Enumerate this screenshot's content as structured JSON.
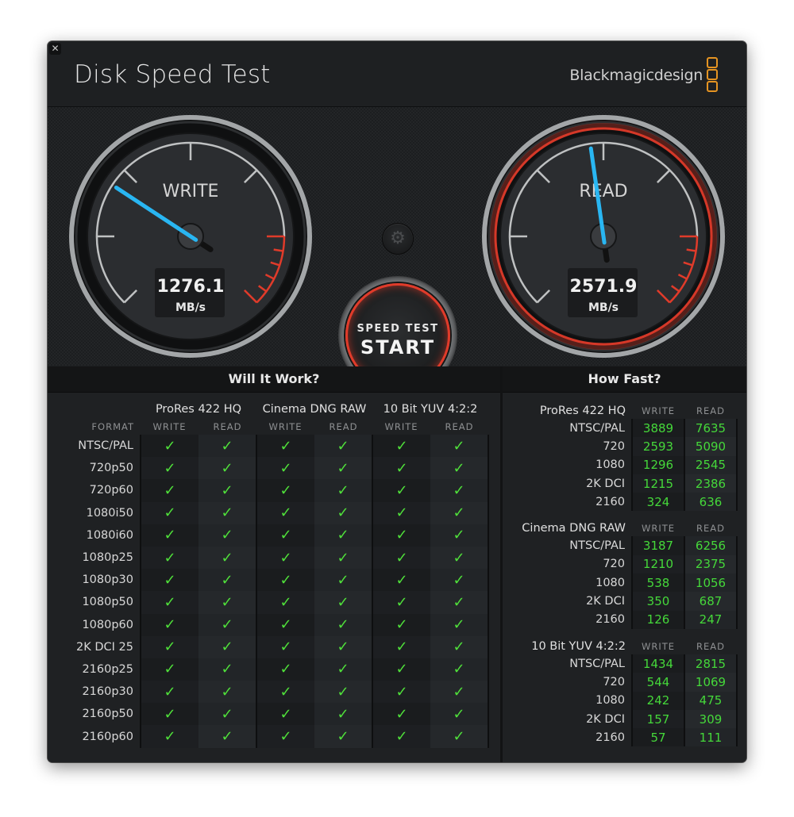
{
  "window": {
    "close_icon": "close-icon",
    "title": "Disk Speed Test",
    "brand": "Blackmagicdesign"
  },
  "colors": {
    "needle": "#29b6f2",
    "danger": "#e03b2a",
    "check": "#4fe03a",
    "value_green": "#45d83a",
    "logo": "#e59422"
  },
  "gauges": {
    "write": {
      "label": "WRITE",
      "value": "1276.1",
      "unit": "MB/s",
      "needle_fraction": 0.29
    },
    "read": {
      "label": "READ",
      "value": "2571.9",
      "unit": "MB/s",
      "needle_fraction": 0.47
    }
  },
  "controls": {
    "settings_icon": "gear-icon",
    "start_sub": "SPEED TEST",
    "start_main": "START"
  },
  "will_it_work": {
    "title": "Will It Work?",
    "format_header": "FORMAT",
    "codecs": [
      "ProRes 422 HQ",
      "Cinema DNG RAW",
      "10 Bit YUV 4:2:2"
    ],
    "columns": [
      "WRITE",
      "READ"
    ],
    "check_glyph": "✓",
    "rows": [
      {
        "format": "NTSC/PAL",
        "results": [
          true,
          true,
          true,
          true,
          true,
          true
        ]
      },
      {
        "format": "720p50",
        "results": [
          true,
          true,
          true,
          true,
          true,
          true
        ]
      },
      {
        "format": "720p60",
        "results": [
          true,
          true,
          true,
          true,
          true,
          true
        ]
      },
      {
        "format": "1080i50",
        "results": [
          true,
          true,
          true,
          true,
          true,
          true
        ]
      },
      {
        "format": "1080i60",
        "results": [
          true,
          true,
          true,
          true,
          true,
          true
        ]
      },
      {
        "format": "1080p25",
        "results": [
          true,
          true,
          true,
          true,
          true,
          true
        ]
      },
      {
        "format": "1080p30",
        "results": [
          true,
          true,
          true,
          true,
          true,
          true
        ]
      },
      {
        "format": "1080p50",
        "results": [
          true,
          true,
          true,
          true,
          true,
          true
        ]
      },
      {
        "format": "1080p60",
        "results": [
          true,
          true,
          true,
          true,
          true,
          true
        ]
      },
      {
        "format": "2K DCI 25",
        "results": [
          true,
          true,
          true,
          true,
          true,
          true
        ]
      },
      {
        "format": "2160p25",
        "results": [
          true,
          true,
          true,
          true,
          true,
          true
        ]
      },
      {
        "format": "2160p30",
        "results": [
          true,
          true,
          true,
          true,
          true,
          true
        ]
      },
      {
        "format": "2160p50",
        "results": [
          true,
          true,
          true,
          true,
          true,
          true
        ]
      },
      {
        "format": "2160p60",
        "results": [
          true,
          true,
          true,
          true,
          true,
          true
        ]
      }
    ]
  },
  "how_fast": {
    "title": "How Fast?",
    "columns": [
      "WRITE",
      "READ"
    ],
    "groups": [
      {
        "codec": "ProRes 422 HQ",
        "rows": [
          {
            "format": "NTSC/PAL",
            "write": "3889",
            "read": "7635"
          },
          {
            "format": "720",
            "write": "2593",
            "read": "5090"
          },
          {
            "format": "1080",
            "write": "1296",
            "read": "2545"
          },
          {
            "format": "2K DCI",
            "write": "1215",
            "read": "2386"
          },
          {
            "format": "2160",
            "write": "324",
            "read": "636"
          }
        ]
      },
      {
        "codec": "Cinema DNG RAW",
        "rows": [
          {
            "format": "NTSC/PAL",
            "write": "3187",
            "read": "6256"
          },
          {
            "format": "720",
            "write": "1210",
            "read": "2375"
          },
          {
            "format": "1080",
            "write": "538",
            "read": "1056"
          },
          {
            "format": "2K DCI",
            "write": "350",
            "read": "687"
          },
          {
            "format": "2160",
            "write": "126",
            "read": "247"
          }
        ]
      },
      {
        "codec": "10 Bit YUV 4:2:2",
        "rows": [
          {
            "format": "NTSC/PAL",
            "write": "1434",
            "read": "2815"
          },
          {
            "format": "720",
            "write": "544",
            "read": "1069"
          },
          {
            "format": "1080",
            "write": "242",
            "read": "475"
          },
          {
            "format": "2K DCI",
            "write": "157",
            "read": "309"
          },
          {
            "format": "2160",
            "write": "57",
            "read": "111"
          }
        ]
      }
    ]
  }
}
